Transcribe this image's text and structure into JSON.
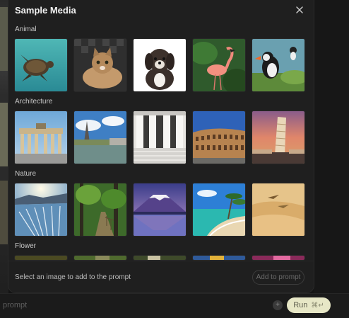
{
  "modal": {
    "title": "Sample Media",
    "footer_text": "Select an image to add to the prompt",
    "add_button_label": "Add to prompt"
  },
  "sections": [
    {
      "label": "Animal",
      "items": [
        "sea-turtle",
        "tabby-kitten",
        "puppy",
        "flamingo",
        "puffin"
      ]
    },
    {
      "label": "Architecture",
      "items": [
        "brandenburg-gate",
        "eiffel-tower-river",
        "neoclassical-columns",
        "colosseum",
        "leaning-tower-pisa"
      ]
    },
    {
      "label": "Nature",
      "items": [
        "glacier",
        "forest-path",
        "mount-fuji-lake",
        "tropical-beach",
        "desert-dunes"
      ]
    },
    {
      "label": "Flower",
      "items": [
        "flower-1",
        "flower-2",
        "flower-3",
        "flower-4",
        "flower-5"
      ]
    }
  ],
  "background": {
    "prompt_hint": "prompt",
    "run_label": "Run",
    "run_shortcut": "⌘↵"
  }
}
